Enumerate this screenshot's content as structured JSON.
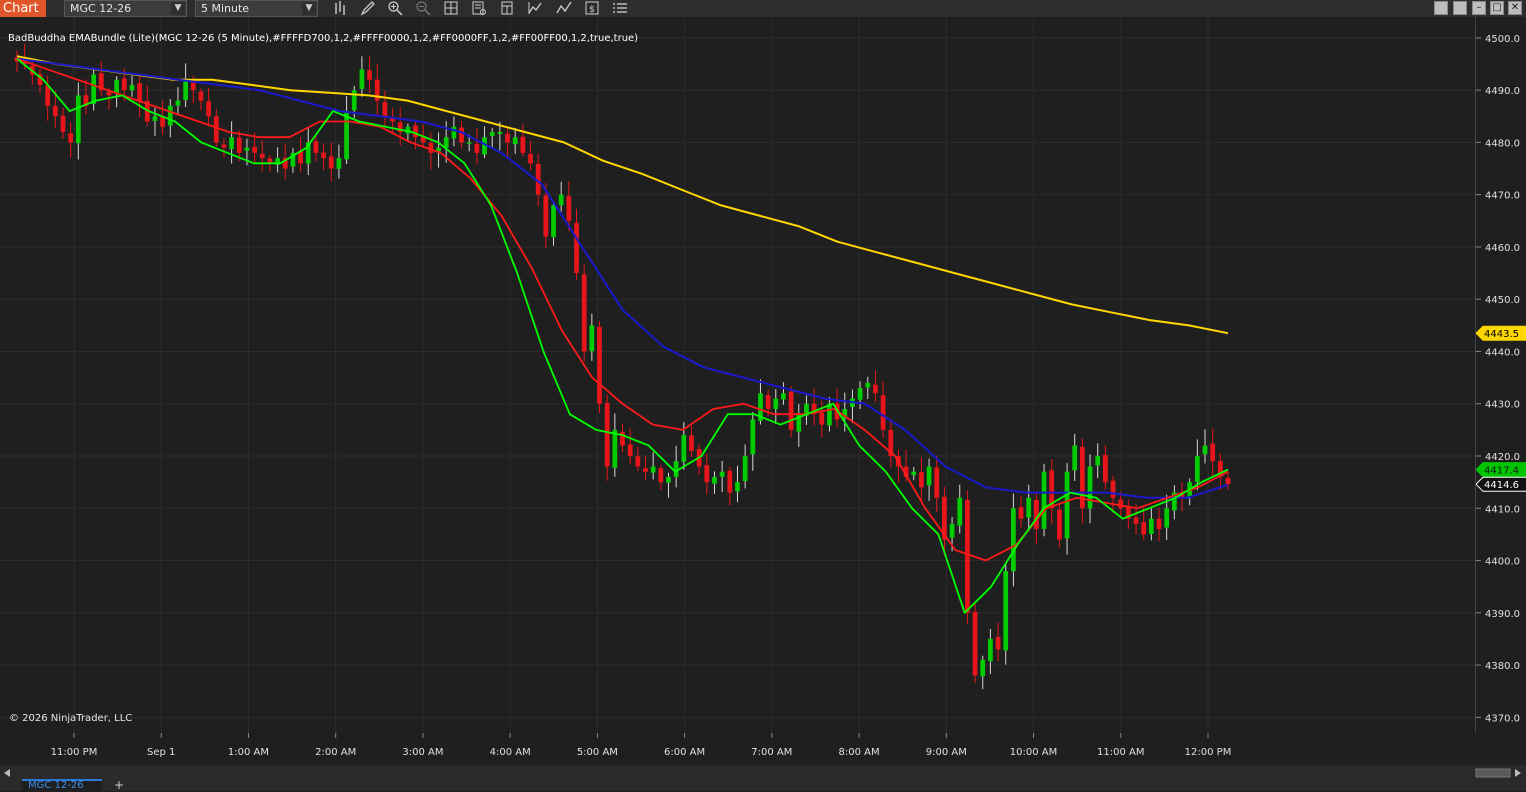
{
  "toolbar": {
    "chart_tab": "Chart",
    "instrument": "MGC 12-26",
    "interval": "5 Minute",
    "tool_icons": [
      "bar-type-icon",
      "draw-pencil-icon",
      "zoom-in-icon",
      "zoom-out-icon",
      "crosshair-icon",
      "data-box-icon",
      "properties-icon",
      "indicators-icon",
      "strategies-icon",
      "text-icon",
      "list-icon"
    ]
  },
  "indicator_label": "BadBuddha EMABundle (Lite)(MGC 12-26 (5 Minute),#FFFFD700,1,2,#FFFF0000,1,2,#FF0000FF,1,2,#FF00FF00,1,2,true,true)",
  "copyright": "© 2026 NinjaTrader, LLC",
  "bottom_tab": "MGC 12-26",
  "colors": {
    "up_candle": "#00cc00",
    "down_candle": "#e8161b",
    "ema_gold": "#ffd700",
    "ema_red": "#ff1a1a",
    "ema_blue": "#1a1acc",
    "ema_green": "#00ff00",
    "price_tag_gold": "#ffd700",
    "price_tag_green": "#00c400",
    "price_tag_last": "#111111"
  },
  "y_axis": {
    "labels": [
      "4500.0",
      "4490.0",
      "4480.0",
      "4470.0",
      "4460.0",
      "4450.0",
      "4440.0",
      "4430.0",
      "4420.0",
      "4410.0",
      "4400.0",
      "4390.0",
      "4380.0",
      "4370.0"
    ]
  },
  "x_axis": {
    "labels": [
      "11:00 PM",
      "Sep 1",
      "1:00 AM",
      "2:00 AM",
      "3:00 AM",
      "4:00 AM",
      "5:00 AM",
      "6:00 AM",
      "7:00 AM",
      "8:00 AM",
      "9:00 AM",
      "10:00 AM",
      "11:00 AM",
      "12:00 PM"
    ]
  },
  "price_markers": {
    "gold_ema": "4443.5",
    "green_ema": "4417.4",
    "last_price": "4414.6"
  },
  "chart_data": {
    "type": "candlestick",
    "instrument": "MGC 12-26",
    "interval": "5 Minute",
    "ylim": [
      4367,
      4504
    ],
    "candles_start": "10:20 PM",
    "candles_end": "12:20 PM",
    "closes": [
      4495.5,
      4495,
      4493,
      4491,
      4487,
      4485,
      4482,
      4480,
      4489,
      4487,
      4493,
      4490,
      4489,
      4492,
      4490,
      4491,
      4488,
      4484,
      4485,
      4483,
      4487,
      4488,
      4492,
      4490,
      4488,
      4485,
      4480,
      4479,
      4481,
      4478,
      4479,
      4478,
      4477,
      4476,
      4477,
      4475,
      4478,
      4476,
      4480,
      4478,
      4477,
      4475,
      4477,
      4486,
      4490,
      4494,
      4492,
      4488,
      4485,
      4484,
      4482,
      4483,
      4481,
      4480,
      4478,
      4479,
      4481,
      4483,
      4480,
      4480,
      4478,
      4481,
      4482,
      4482,
      4480,
      4481,
      4478,
      4476,
      4470,
      4462,
      4468,
      4470,
      4465,
      4455,
      4440,
      4445,
      4430,
      4418,
      4425,
      4422,
      4420,
      4418,
      4417,
      4418,
      4415,
      4416,
      4419,
      4424,
      4421,
      4418,
      4415,
      4416,
      4417,
      4413,
      4415,
      4420,
      4427,
      4432,
      4429,
      4431,
      4432,
      4425,
      4428,
      4430,
      4428,
      4426,
      4430,
      4427,
      4429,
      4431,
      4433,
      4434,
      4432,
      4425,
      4420,
      4418,
      4416,
      4417,
      4414,
      4418,
      4412,
      4404,
      4407,
      4412,
      4390,
      4378,
      4381,
      4385,
      4383,
      4398,
      4410,
      4408,
      4412,
      4406,
      4417,
      4410,
      4404,
      4417,
      4422,
      4410,
      4418,
      4420,
      4415,
      4412,
      4410,
      4408,
      4407,
      4405,
      4408,
      4406,
      4410,
      4413,
      4412,
      4415,
      4420,
      4422,
      4419,
      4416,
      4414.6
    ],
    "ema_gold": [
      4496.5,
      4495,
      4494,
      4493,
      4492,
      4492,
      4491,
      4490,
      4489.5,
      4489,
      4488,
      4486,
      4484,
      4482,
      4480,
      4476.5,
      4474,
      4471,
      4468,
      4466,
      4464,
      4461,
      4459,
      4457,
      4455,
      4453,
      4451,
      4449,
      4447.5,
      4446,
      4445,
      4443.5
    ],
    "ema_red": [
      4496,
      4494,
      4492,
      4490,
      4488,
      4486,
      4484,
      4482,
      4481,
      4481,
      4484,
      4484,
      4483,
      4480,
      4478,
      4473,
      4466,
      4456,
      4444,
      4435,
      4430,
      4426,
      4425,
      4429,
      4430,
      4428,
      4428,
      4429,
      4425,
      4420,
      4410,
      4402,
      4400,
      4403,
      4410,
      4412,
      4411,
      4410,
      4412,
      4414,
      4417
    ],
    "ema_blue": [
      4496,
      4495,
      4494,
      4493,
      4492,
      4491,
      4490,
      4488,
      4486,
      4485,
      4484,
      4482,
      4478,
      4472,
      4460,
      4448,
      4441,
      4437,
      4435,
      4433,
      4431,
      4430,
      4425,
      4418,
      4414,
      4413,
      4413,
      4413,
      4412,
      4412,
      4414.5
    ],
    "ema_green": [
      4496,
      4492,
      4486,
      4488,
      4489,
      4486,
      4484,
      4480,
      4478,
      4476,
      4476,
      4479,
      4486,
      4484,
      4483,
      4482,
      4480,
      4476,
      4468,
      4455,
      4440,
      4428,
      4425,
      4424,
      4422,
      4417,
      4420,
      4428,
      4428,
      4426,
      4428,
      4430,
      4422,
      4417,
      4410,
      4405,
      4390,
      4395,
      4403,
      4410,
      4413,
      4412,
      4408,
      4410,
      4412,
      4415,
      4417.4
    ]
  }
}
